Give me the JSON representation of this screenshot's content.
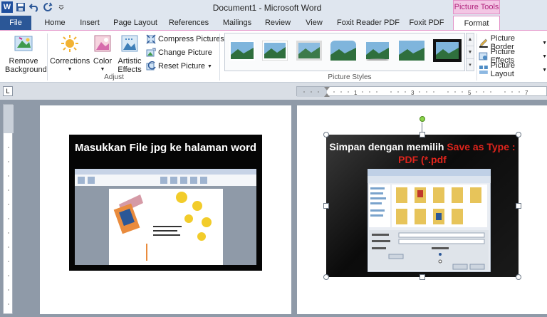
{
  "window": {
    "title": "Document1 - Microsoft Word",
    "context_tab": "Picture Tools"
  },
  "tabs": [
    "File",
    "Home",
    "Insert",
    "Page Layout",
    "References",
    "Mailings",
    "Review",
    "View",
    "Foxit Reader PDF",
    "Foxit PDF",
    "Format"
  ],
  "ribbon": {
    "remove_background": "Remove Background",
    "corrections": "Corrections",
    "color": "Color",
    "artistic_effects": "Artistic Effects",
    "compress_pictures": "Compress Pictures",
    "change_picture": "Change Picture",
    "reset_picture": "Reset Picture",
    "adjust_group": "Adjust",
    "picture_styles_group": "Picture Styles",
    "picture_border": "Picture Border",
    "picture_effects": "Picture Effects",
    "picture_layout": "Picture Layout"
  },
  "page1": {
    "slide_title": "Masukkan File jpg ke halaman word"
  },
  "page2": {
    "slide_title_white": "Simpan dengan memilih ",
    "slide_title_red": "Save as Type : PDF (*.pdf"
  },
  "colors": {
    "file_tab": "#2b5797",
    "accent": "#e28fc6",
    "red_text": "#e0241c"
  }
}
